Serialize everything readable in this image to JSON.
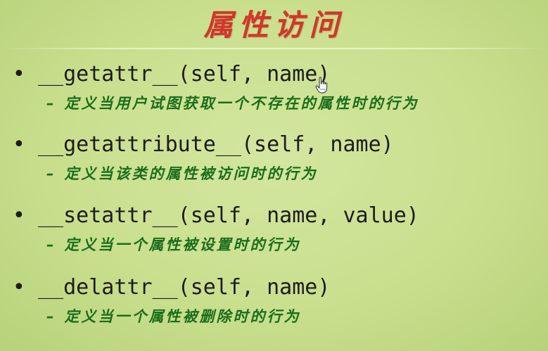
{
  "slide": {
    "title": "属性访问",
    "items": [
      {
        "bullet": "•",
        "method": "__getattr__(self, name)",
        "dash": "–",
        "description": "定义当用户试图获取一个不存在的属性时的行为"
      },
      {
        "bullet": "•",
        "method": "__getattribute__(self, name)",
        "dash": "–",
        "description": "定义当该类的属性被访问时的行为"
      },
      {
        "bullet": "•",
        "method": "__setattr__(self, name, value)",
        "dash": "–",
        "description": "定义当一个属性被设置时的行为"
      },
      {
        "bullet": "•",
        "method": "__delattr__(self, name)",
        "dash": "–",
        "description": "定义当一个属性被删除时的行为"
      }
    ]
  },
  "cursor": {
    "icon": "hand-pointer-icon"
  },
  "colors": {
    "title": "#d2362a",
    "description": "#1a6e1a",
    "method": "#1c1c1c",
    "background": "#c9df8e"
  }
}
